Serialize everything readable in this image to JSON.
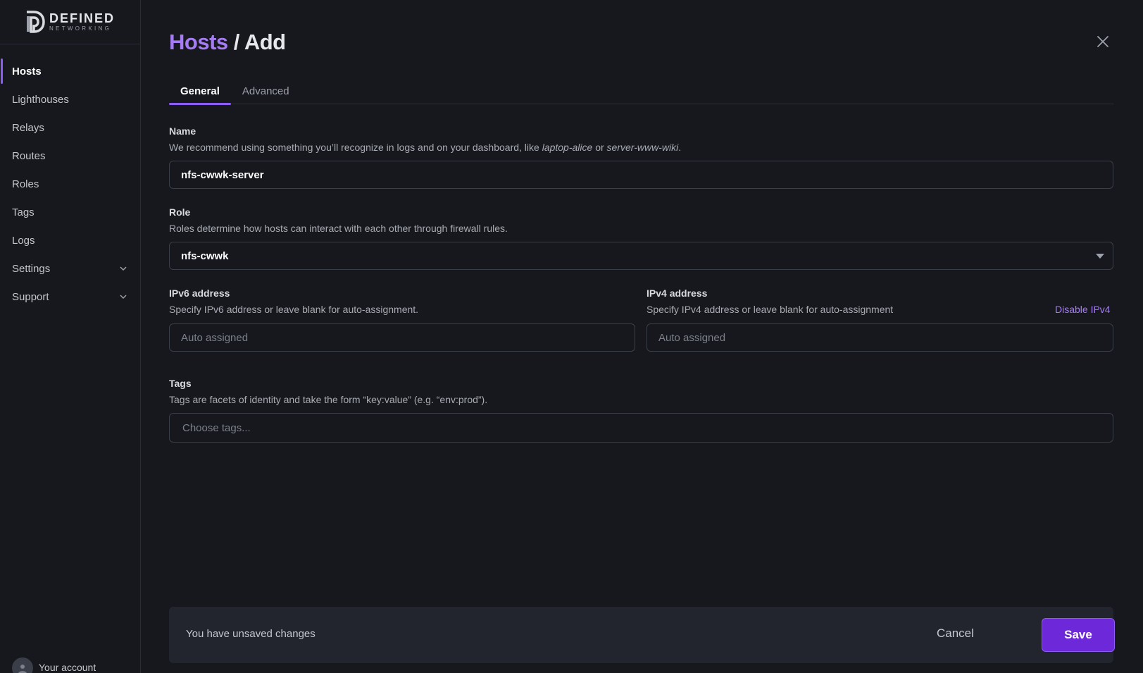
{
  "brand": {
    "word": "DEFINED",
    "sub": "NETWORKING"
  },
  "sidebar": {
    "items": [
      {
        "label": "Hosts",
        "active": true
      },
      {
        "label": "Lighthouses"
      },
      {
        "label": "Relays"
      },
      {
        "label": "Routes"
      },
      {
        "label": "Roles"
      },
      {
        "label": "Tags"
      },
      {
        "label": "Logs"
      },
      {
        "label": "Settings",
        "expandable": true
      },
      {
        "label": "Support",
        "expandable": true
      }
    ],
    "account_label": "Your account"
  },
  "header": {
    "breadcrumb": "Hosts",
    "separator": " / ",
    "title": "Add"
  },
  "tabs": [
    {
      "label": "General",
      "active": true
    },
    {
      "label": "Advanced"
    }
  ],
  "form": {
    "name": {
      "label": "Name",
      "help_prefix": "We recommend using something you’ll recognize in logs and on your dashboard, like ",
      "example_1": "laptop-alice",
      "help_mid": " or ",
      "example_2": "server-www-wiki",
      "help_suffix": ".",
      "value": "nfs-cwwk-server"
    },
    "role": {
      "label": "Role",
      "help": "Roles determine how hosts can interact with each other through firewall rules.",
      "value": "nfs-cwwk"
    },
    "ipv6": {
      "label": "IPv6 address",
      "help": "Specify IPv6 address or leave blank for auto-assignment.",
      "placeholder": "Auto assigned"
    },
    "ipv4": {
      "label": "IPv4 address",
      "help": "Specify IPv4 address or leave blank for auto-assignment",
      "placeholder": "Auto assigned",
      "disable_link": "Disable IPv4"
    },
    "tags": {
      "label": "Tags",
      "help": "Tags are facets of identity and take the form “key:value” (e.g. “env:prod”).",
      "placeholder": "Choose tags..."
    }
  },
  "footer": {
    "message": "You have unsaved changes",
    "cancel_label": "Cancel",
    "save_label": "Save"
  },
  "colors": {
    "accent": "#8b5cf6",
    "save_bg": "#6d28d9",
    "breadcrumb": "#a67cf5",
    "background": "#16181e"
  }
}
